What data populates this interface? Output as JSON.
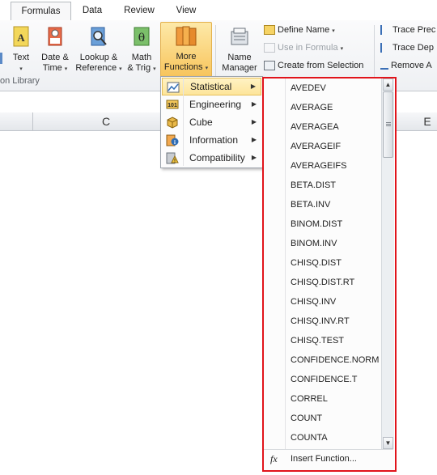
{
  "tabs": [
    {
      "label": "Formulas",
      "active": true
    },
    {
      "label": "Data",
      "active": false
    },
    {
      "label": "Review",
      "active": false
    },
    {
      "label": "View",
      "active": false
    }
  ],
  "ribbon": {
    "text_label": "Text",
    "date_time_label": "Date &",
    "date_time_label2": "Time",
    "lookup_label": "Lookup &",
    "lookup_label2": "Reference",
    "math_label": "Math",
    "math_label2": "& Trig",
    "more_label": "More",
    "more_label2": "Functions",
    "name_manager_label": "Name",
    "name_manager_label2": "Manager",
    "define_name": "Define Name",
    "use_in_formula": "Use in Formula",
    "create_from_selection": "Create from Selection",
    "trace_precedents": "Trace Prec",
    "trace_dependents": "Trace Dep",
    "remove_arrows": "Remove A",
    "group_label": "on Library",
    "dropdown_glyph": "▾"
  },
  "sheet": {
    "columns": [
      "C",
      "E"
    ]
  },
  "category_menu": {
    "items": [
      {
        "label": "Statistical",
        "icon": "chart-icon"
      },
      {
        "label": "Engineering",
        "icon": "engineering-icon"
      },
      {
        "label": "Cube",
        "icon": "cube-icon"
      },
      {
        "label": "Information",
        "icon": "info-icon"
      },
      {
        "label": "Compatibility",
        "icon": "compatibility-icon"
      }
    ],
    "arrow": "▶"
  },
  "function_list": {
    "items": [
      "AVEDEV",
      "AVERAGE",
      "AVERAGEA",
      "AVERAGEIF",
      "AVERAGEIFS",
      "BETA.DIST",
      "BETA.INV",
      "BINOM.DIST",
      "BINOM.INV",
      "CHISQ.DIST",
      "CHISQ.DIST.RT",
      "CHISQ.INV",
      "CHISQ.INV.RT",
      "CHISQ.TEST",
      "CONFIDENCE.NORM",
      "CONFIDENCE.T",
      "CORREL",
      "COUNT",
      "COUNTA"
    ],
    "insert_function": "Insert Function...",
    "fx_glyph": "fx",
    "scroll_up": "▲",
    "scroll_down": "▼"
  },
  "colors": {
    "highlight_border": "#e1141b",
    "menu_highlight": "#fde59a"
  }
}
